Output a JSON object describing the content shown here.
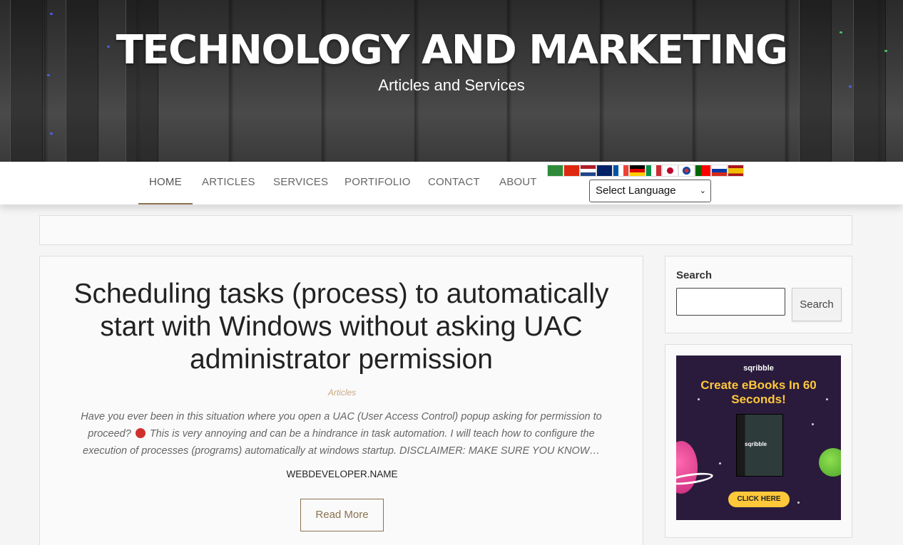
{
  "header": {
    "site_title": "TECHNOLOGY AND MARKETING",
    "tagline": "Articles and Services"
  },
  "nav": {
    "items": [
      {
        "label": "HOME",
        "active": true
      },
      {
        "label": "ARTICLES",
        "active": false
      },
      {
        "label": "SERVICES",
        "active": false
      },
      {
        "label": "PORTIFOLIO",
        "active": false
      },
      {
        "label": "CONTACT",
        "active": false
      },
      {
        "label": "ABOUT",
        "active": false
      }
    ],
    "flags": [
      "arabic-flag-icon",
      "chinese-flag-icon",
      "dutch-flag-icon",
      "english-flag-icon",
      "french-flag-icon",
      "german-flag-icon",
      "italian-flag-icon",
      "japanese-flag-icon",
      "korean-flag-icon",
      "portuguese-flag-icon",
      "russian-flag-icon",
      "spanish-flag-icon"
    ],
    "language_select": "Select Language"
  },
  "article": {
    "title": "Scheduling tasks (process) to automatically start with Windows without asking UAC administrator permission",
    "category": "Articles",
    "excerpt_part1": "Have you ever been in this situation where you open a UAC (User Access Control) popup asking for permission to proceed?",
    "excerpt_part2": "  This is very annoying and can be a hindrance in task automation. I will teach how to configure the execution of processes (programs) automatically at windows startup. DISCLAIMER: MAKE SURE YOU KNOW…",
    "author": "WEBDEVELOPER.NAME",
    "read_more": "Read More"
  },
  "sidebar": {
    "search_label": "Search",
    "search_value": "",
    "search_button": "Search",
    "ad": {
      "brand": "sqribble",
      "headline": "Create eBooks In 60 Seconds!",
      "book_label": "sqribble",
      "cta": "CLICK HERE"
    }
  },
  "colors": {
    "accent": "#8a7350",
    "category": "#c9a882"
  }
}
